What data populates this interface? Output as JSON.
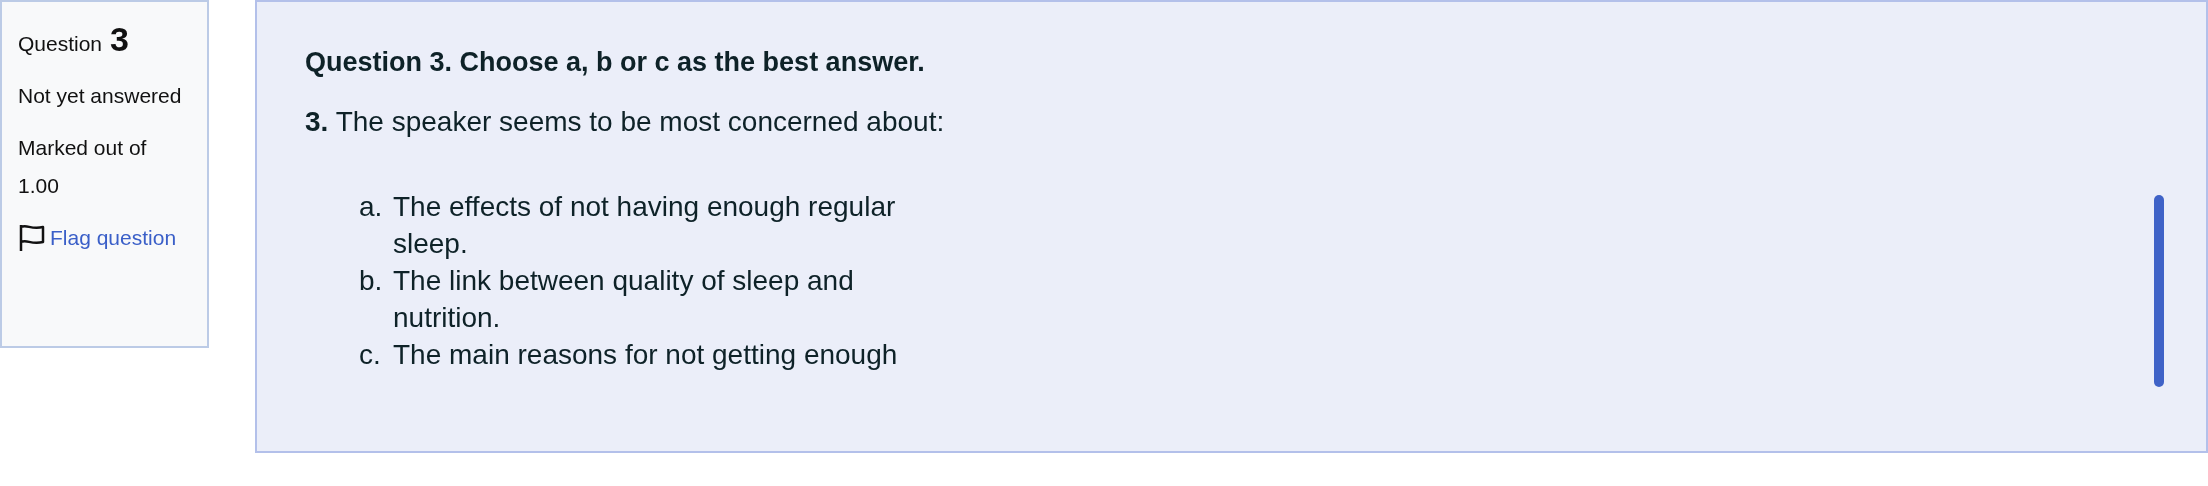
{
  "info": {
    "label": "Question",
    "number": "3",
    "status": "Not yet answered",
    "marks": "Marked out of 1.00",
    "flag_link": "Flag question"
  },
  "question": {
    "heading": "Question 3. Choose a, b or c as the best answer.",
    "prompt": "**3.** The speaker seems to be most concerned about:",
    "options": [
      {
        "letter": "a.",
        "text": "The effects of not having enough regular sleep."
      },
      {
        "letter": "b.",
        "text": "The link between quality of sleep and nutrition."
      },
      {
        "letter": "c.",
        "text": "The main reasons for not getting enough"
      }
    ]
  }
}
